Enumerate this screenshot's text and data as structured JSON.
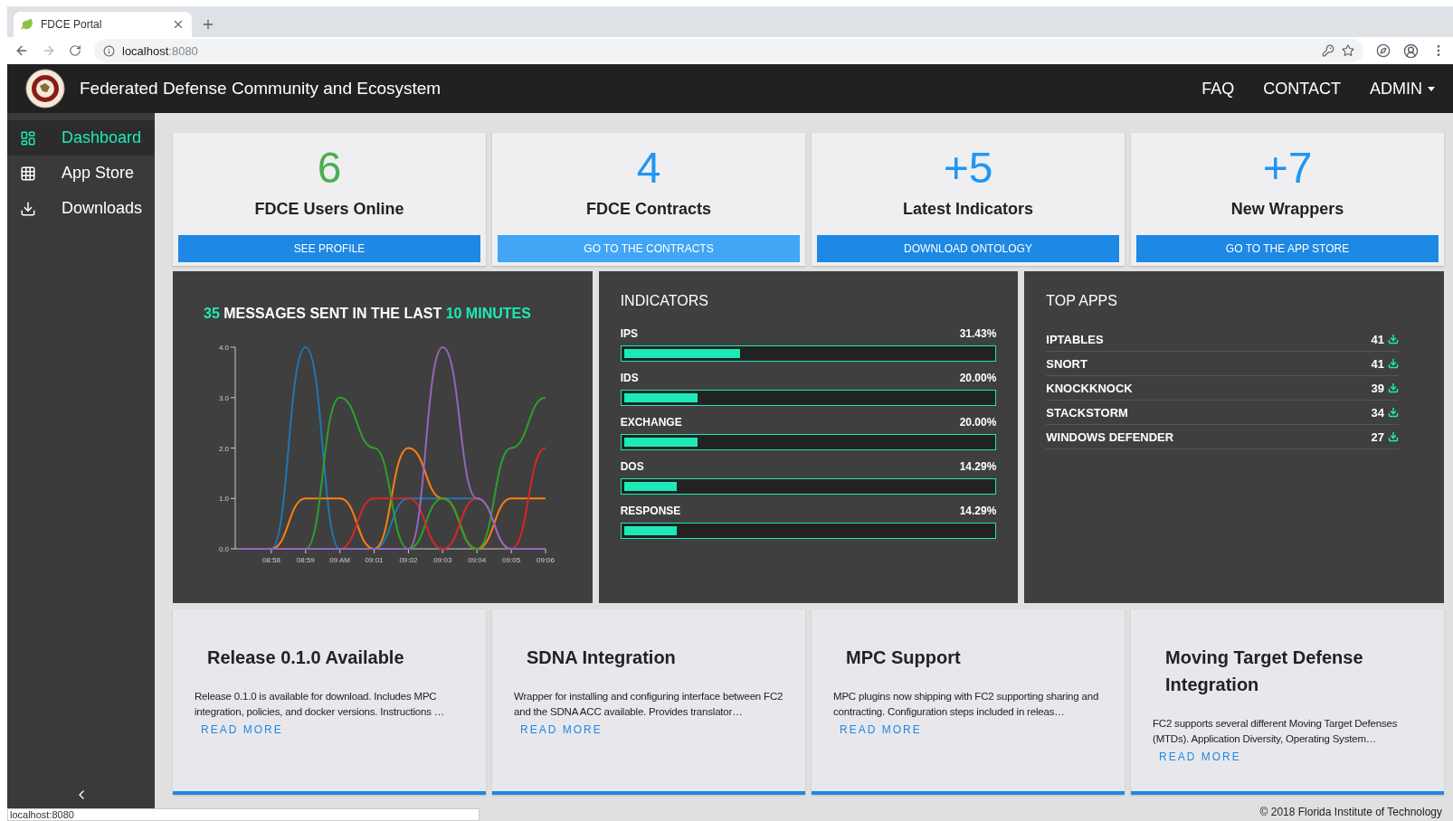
{
  "browser": {
    "tab": {
      "title": "FDCE Portal"
    },
    "address": {
      "host": "localhost",
      "port": ":8080"
    },
    "status_text": "localhost:8080"
  },
  "header": {
    "title": "Federated Defense Community and Ecosystem",
    "nav": [
      {
        "label": "FAQ",
        "kind": "link"
      },
      {
        "label": "CONTACT",
        "kind": "link"
      },
      {
        "label": "ADMIN",
        "kind": "dropdown"
      }
    ]
  },
  "sidebar": {
    "items": [
      {
        "label": "Dashboard",
        "kind": "dashboard",
        "selected": true
      },
      {
        "label": "App Store",
        "kind": "apps",
        "selected": false
      },
      {
        "label": "Downloads",
        "kind": "downloads",
        "selected": false
      }
    ]
  },
  "stats": [
    {
      "value": "6",
      "label": "FDCE Users Online",
      "color": "#4caf50",
      "button": "SEE PROFILE",
      "hovered": false
    },
    {
      "value": "4",
      "label": "FDCE Contracts",
      "color": "#2196f3",
      "button": "GO TO THE CONTRACTS",
      "hovered": true
    },
    {
      "value": "+5",
      "label": "Latest Indicators",
      "color": "#2196f3",
      "button": "DOWNLOAD ONTOLOGY",
      "hovered": false
    },
    {
      "value": "+7",
      "label": "New Wrappers",
      "color": "#2196f3",
      "button": "GO TO THE APP STORE",
      "hovered": false
    }
  ],
  "messages": {
    "count": "35",
    "text": "MESSAGES SENT IN THE LAST",
    "period": "10 MINUTES",
    "chart_data": {
      "type": "line",
      "categories": [
        null,
        "08:58",
        "08:59",
        "09 AM",
        "09:01",
        "09:02",
        "09:03",
        "09:04",
        "09:05",
        "09:06"
      ],
      "ylim": [
        0,
        4
      ],
      "yticks": [
        {
          "value": 0,
          "label": "0.0"
        },
        {
          "value": 1,
          "label": "1.0"
        },
        {
          "value": 2,
          "label": "2.0"
        },
        {
          "value": 3,
          "label": "3.0"
        },
        {
          "value": 4,
          "label": "4.0"
        }
      ],
      "series": [
        {
          "color": "#1f77b4",
          "values": [
            0,
            0,
            4,
            0,
            0,
            1,
            1,
            1,
            0,
            0
          ]
        },
        {
          "color": "#ff7f0e",
          "values": [
            0,
            0,
            1,
            1,
            0,
            2,
            1,
            0,
            1,
            1
          ]
        },
        {
          "color": "#2ca02c",
          "values": [
            0,
            0,
            0,
            3,
            2,
            0,
            1,
            0,
            2,
            3
          ]
        },
        {
          "color": "#d62728",
          "values": [
            null,
            null,
            0,
            0,
            1,
            1,
            0,
            1,
            0,
            2
          ]
        },
        {
          "color": "#9467bd",
          "values": [
            0,
            0,
            0,
            0,
            0,
            0,
            4,
            1,
            0,
            0
          ]
        }
      ]
    }
  },
  "indicators": {
    "title": "INDICATORS",
    "items": [
      {
        "name": "IPS",
        "reading": "31.43%",
        "level": 0.3143
      },
      {
        "name": "IDS",
        "reading": "20.00%",
        "level": 0.2
      },
      {
        "name": "EXCHANGE",
        "reading": "20.00%",
        "level": 0.2
      },
      {
        "name": "DOS",
        "reading": "14.29%",
        "level": 0.1429
      },
      {
        "name": "RESPONSE",
        "reading": "14.29%",
        "level": 0.1429
      }
    ]
  },
  "top_apps": {
    "title": "TOP APPS",
    "items": [
      {
        "name": "IPTABLES",
        "count": "41"
      },
      {
        "name": "SNORT",
        "count": "41"
      },
      {
        "name": "KNOCKKNOCK",
        "count": "39"
      },
      {
        "name": "STACKSTORM",
        "count": "34"
      },
      {
        "name": "WINDOWS DEFENDER",
        "count": "27"
      }
    ]
  },
  "news": [
    {
      "title": "Release 0.1.0 Available",
      "text": "Release 0.1.0 is available for download. Includes MPC integration, policies, and docker versions. Instructions …",
      "link": "READ MORE"
    },
    {
      "title": "SDNA Integration",
      "text": "Wrapper for installing and configuring interface between FC2 and the SDNA ACC available. Provides translator…",
      "link": "READ MORE"
    },
    {
      "title": "MPC Support",
      "text": "MPC plugins now shipping with FC2 supporting sharing and contracting. Configuration steps included in releas…",
      "link": "READ MORE"
    },
    {
      "title": "Moving Target Defense Integration",
      "text": "FC2 supports several different Moving Target Defenses (MTDs). Application Diversity, Operating System…",
      "link": "READ MORE"
    }
  ],
  "footer": {
    "copyright": "© 2018 Florida Institute of Technology"
  }
}
